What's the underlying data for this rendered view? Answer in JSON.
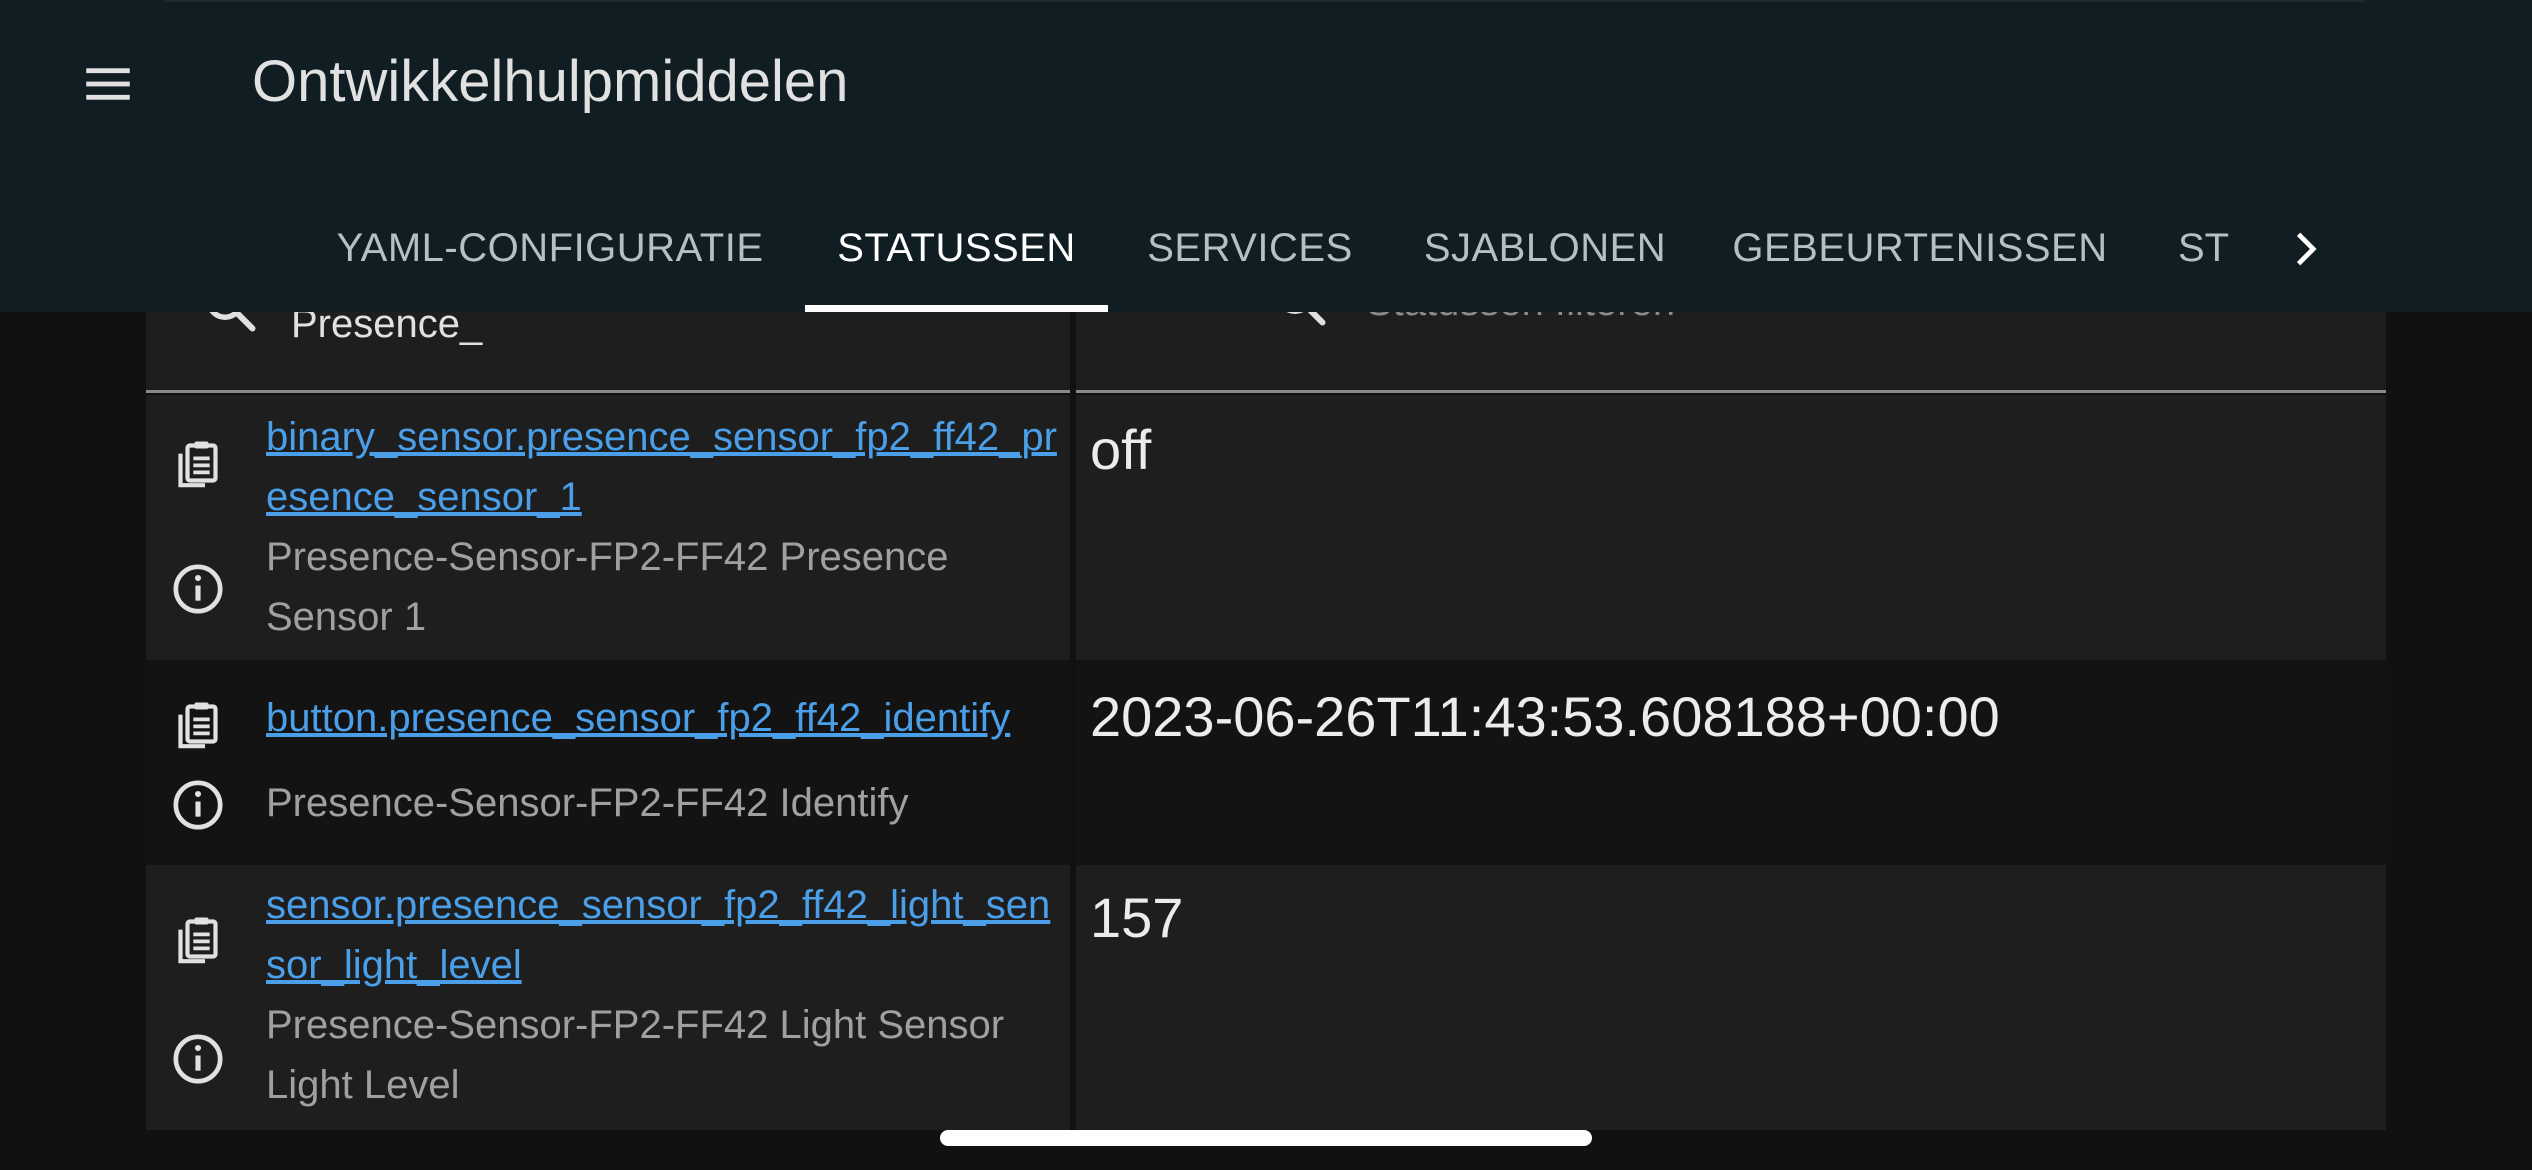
{
  "header": {
    "title": "Ontwikkelhulpmiddelen",
    "menu_icon": "hamburger-menu-icon",
    "tabs": [
      {
        "label": "YAML-CONFIGURATIE"
      },
      {
        "label": "STATUSSEN"
      },
      {
        "label": "SERVICES"
      },
      {
        "label": "SJABLONEN"
      },
      {
        "label": "GEBEURTENISSEN"
      },
      {
        "label": "ST"
      }
    ],
    "active_tab": "STATUSSEN",
    "scroll_icon": "chevron-right-icon"
  },
  "filters": {
    "entity_value": "Presence_",
    "state_placeholder": "Statussen filteren"
  },
  "rows": [
    {
      "entity_id": "binary_sensor.presence_sensor_fp2_ff42_presence_sensor_1",
      "friendly_name": "Presence-Sensor-FP2-FF42 Presence Sensor 1",
      "state": "off"
    },
    {
      "entity_id": "button.presence_sensor_fp2_ff42_identify",
      "friendly_name": "Presence-Sensor-FP2-FF42 Identify",
      "state": "2023-06-26T11:43:53.608188+00:00"
    },
    {
      "entity_id": "sensor.presence_sensor_fp2_ff42_light_sensor_light_level",
      "friendly_name": "Presence-Sensor-FP2-FF42 Light Sensor Light Level",
      "state": "157"
    }
  ],
  "colors": {
    "header_bg": "#101e24",
    "link": "#4a9fe8",
    "page_bg": "#111111"
  }
}
